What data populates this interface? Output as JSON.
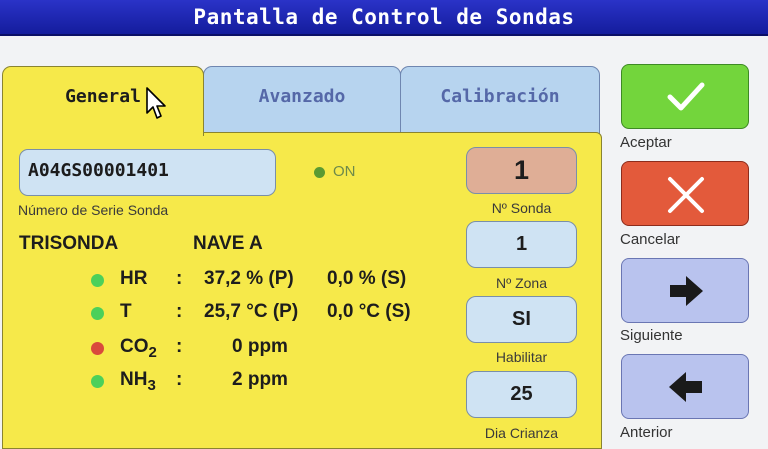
{
  "window": {
    "title": "Pantalla de Control de Sondas"
  },
  "tabs": [
    {
      "label": "General",
      "active": true
    },
    {
      "label": "Avanzado",
      "active": false
    },
    {
      "label": "Calibración",
      "active": false
    }
  ],
  "probe": {
    "serial_value": "A04GS00001401",
    "serial_caption": "Número de Serie Sonda",
    "status_label": "ON",
    "type": "TRISONDA",
    "location": "NAVE A"
  },
  "readings": [
    {
      "name": "HR",
      "sub": "",
      "colon": ":",
      "primary": "37,2 % (P)",
      "secondary": "0,0 % (S)",
      "status_color": "#4cd05a"
    },
    {
      "name": "T",
      "sub": "",
      "colon": ":",
      "primary": "25,7 °C (P)",
      "secondary": "0,0 °C (S)",
      "status_color": "#4cd05a"
    },
    {
      "name": "CO",
      "sub": "2",
      "colon": ":",
      "primary": "0 ppm",
      "secondary": "",
      "status_color": "#d94a3c"
    },
    {
      "name": "NH",
      "sub": "3",
      "colon": ":",
      "primary": "2 ppm",
      "secondary": "",
      "status_color": "#4cd05a"
    }
  ],
  "fields": [
    {
      "value": "1",
      "caption": "Nº Sonda"
    },
    {
      "value": "1",
      "caption": "Nº Zona"
    },
    {
      "value": "SI",
      "caption": "Habilitar"
    },
    {
      "value": "25",
      "caption": "Dia Crianza"
    }
  ],
  "actions": {
    "accept": "Aceptar",
    "cancel": "Cancelar",
    "next": "Siguiente",
    "previous": "Anterior"
  },
  "colors": {
    "title_bar": "#1e27b4",
    "panel": "#f6e94a",
    "accept": "#73d53c",
    "cancel": "#e35a3b",
    "nav": "#b9c3ee"
  },
  "icons": {
    "accept": "check-icon",
    "cancel": "x-icon",
    "next": "arrow-right-icon",
    "previous": "arrow-left-icon",
    "cursor": "mouse-cursor-icon"
  }
}
